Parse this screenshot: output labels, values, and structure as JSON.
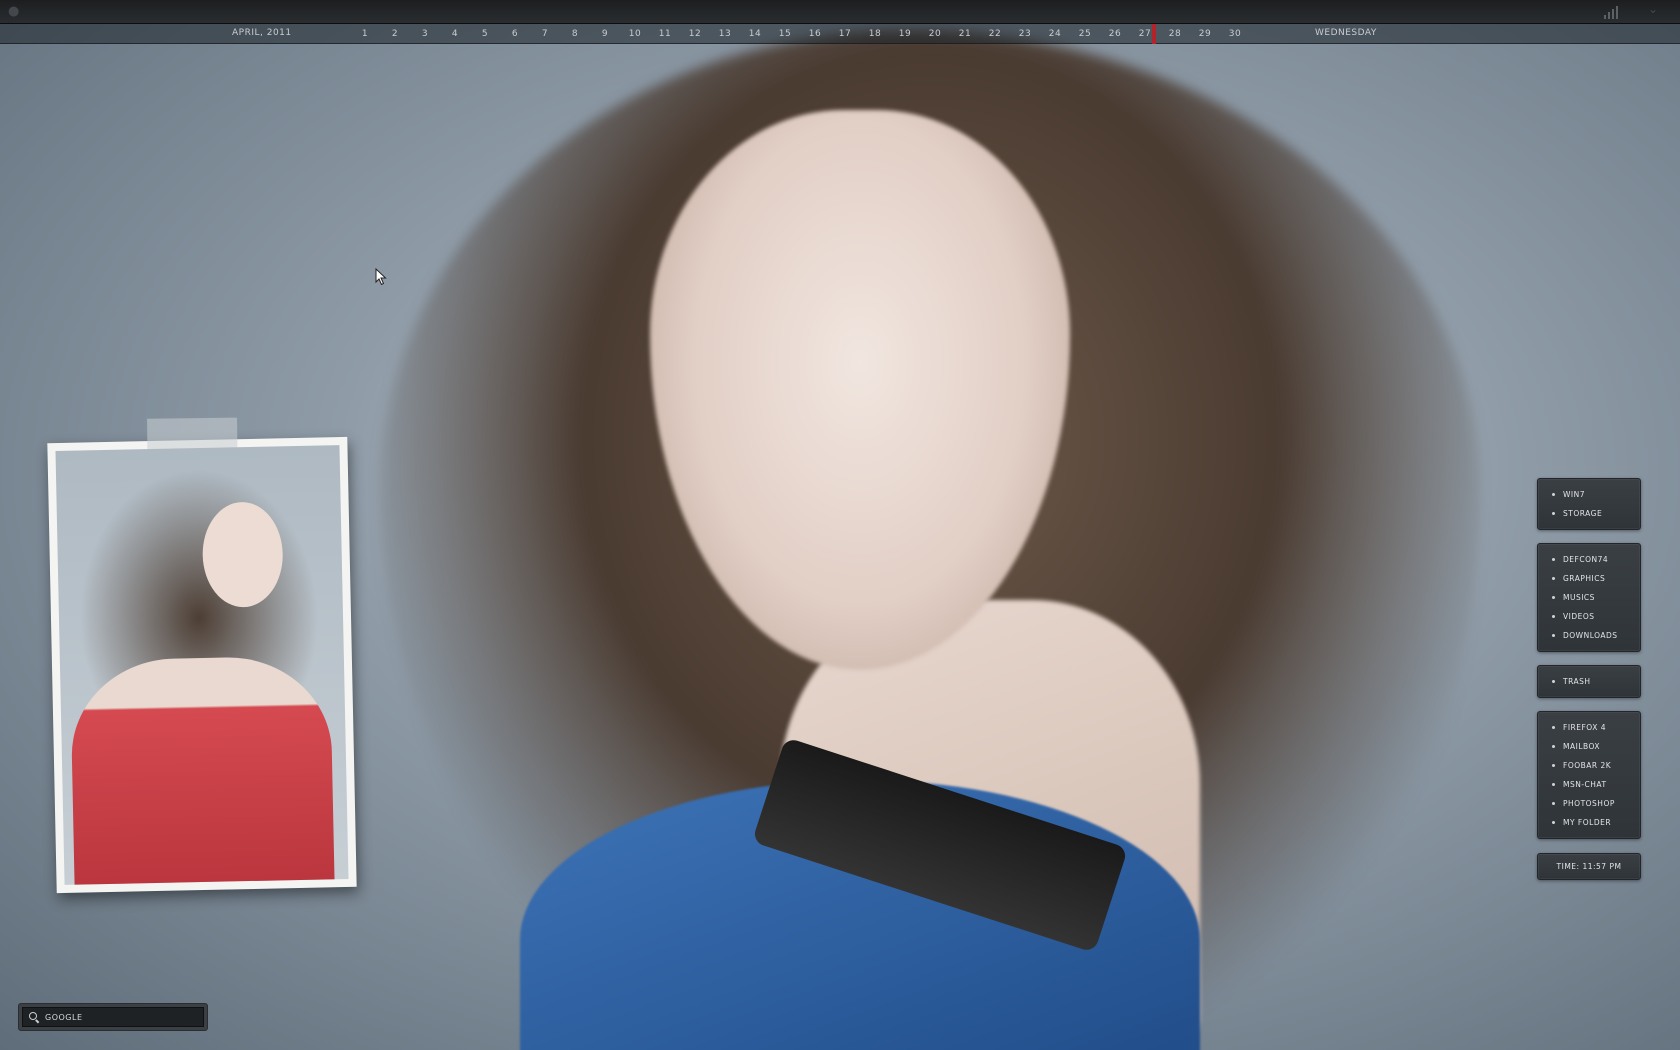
{
  "calendar": {
    "month": "April, 2011",
    "days": [
      "1",
      "2",
      "3",
      "4",
      "5",
      "6",
      "7",
      "8",
      "9",
      "10",
      "11",
      "12",
      "13",
      "14",
      "15",
      "16",
      "17",
      "18",
      "19",
      "20",
      "21",
      "22",
      "23",
      "24",
      "25",
      "26",
      "27",
      "28",
      "29",
      "30"
    ],
    "today_index": 26,
    "weekday": "Wednesday",
    "today_marker_color": "#b3232a"
  },
  "search": {
    "placeholder": "Google"
  },
  "dock": {
    "group1": [
      "Win7",
      "Storage"
    ],
    "group2": [
      "Defcon74",
      "Graphics",
      "Musics",
      "Videos",
      "Downloads"
    ],
    "group3": [
      "Trash"
    ],
    "group4": [
      "Firefox 4",
      "Mailbox",
      "Foobar 2K",
      "MSN-Chat",
      "Photoshop",
      "My Folder"
    ]
  },
  "clock": {
    "label": "Time: 11:57 PM"
  },
  "icons": {
    "top_left": "apple-icon",
    "top_right_signal": "signal-icon",
    "top_right_chevron": "chevron-down-icon",
    "search": "search-icon"
  }
}
